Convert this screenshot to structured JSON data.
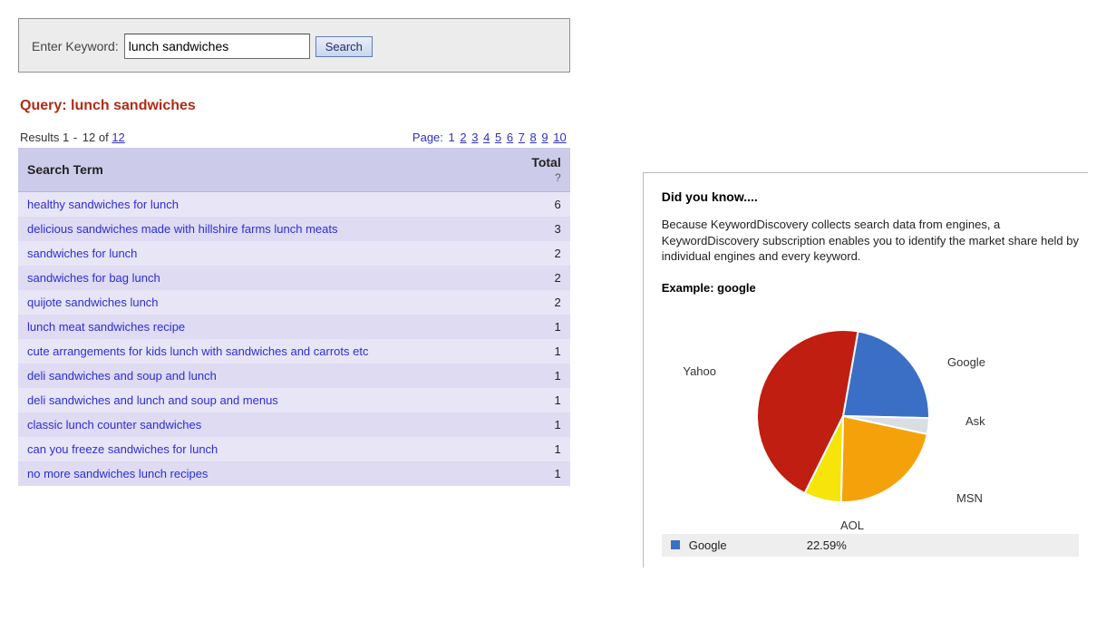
{
  "search": {
    "label": "Enter Keyword:",
    "value": "lunch sandwiches",
    "button": "Search"
  },
  "query": {
    "prefix": "Query: ",
    "term": "lunch sandwiches"
  },
  "results_bar": {
    "prefix": "Results ",
    "from": "1",
    "dash": " - ",
    "to": "12",
    "of": " of ",
    "total": "12",
    "page_label": "Page: "
  },
  "pager": {
    "pages": [
      "1",
      "2",
      "3",
      "4",
      "5",
      "6",
      "7",
      "8",
      "9",
      "10"
    ],
    "current_index": 0
  },
  "table": {
    "col_term": "Search Term",
    "col_total": "Total",
    "total_help": "?",
    "rows": [
      {
        "term": "healthy sandwiches for lunch",
        "total": "6"
      },
      {
        "term": "delicious sandwiches made with hillshire farms lunch meats",
        "total": "3"
      },
      {
        "term": "sandwiches for lunch",
        "total": "2"
      },
      {
        "term": "sandwiches for bag lunch",
        "total": "2"
      },
      {
        "term": "quijote sandwiches lunch",
        "total": "2"
      },
      {
        "term": "lunch meat sandwiches recipe",
        "total": "1"
      },
      {
        "term": "cute arrangements for kids lunch with sandwiches and carrots etc",
        "total": "1"
      },
      {
        "term": "deli sandwiches and soup and lunch",
        "total": "1"
      },
      {
        "term": "deli sandwiches and lunch and soup and menus",
        "total": "1"
      },
      {
        "term": "classic lunch counter sandwiches",
        "total": "1"
      },
      {
        "term": "can you freeze sandwiches for lunch",
        "total": "1"
      },
      {
        "term": "no more sandwiches lunch recipes",
        "total": "1"
      }
    ]
  },
  "sidebar": {
    "title": "Did you know....",
    "text": "Because KeywordDiscovery collects search data from engines, a KeywordDiscovery subscription enables you to identify the market share held by individual engines and every keyword.",
    "example_label": "Example: google",
    "legend": {
      "name": "Google",
      "value": "22.59%",
      "color": "#3b6fc6"
    }
  },
  "chart_data": {
    "type": "pie",
    "title": "",
    "series": [
      {
        "name": "Google",
        "value": 22.59,
        "color": "#3b6fc6"
      },
      {
        "name": "Ask",
        "value": 3.0,
        "color": "#d9dde4"
      },
      {
        "name": "MSN",
        "value": 22.0,
        "color": "#f5a20a"
      },
      {
        "name": "AOL",
        "value": 7.0,
        "color": "#f7e40b"
      },
      {
        "name": "Yahoo",
        "value": 45.41,
        "color": "#bf1e10"
      }
    ]
  }
}
